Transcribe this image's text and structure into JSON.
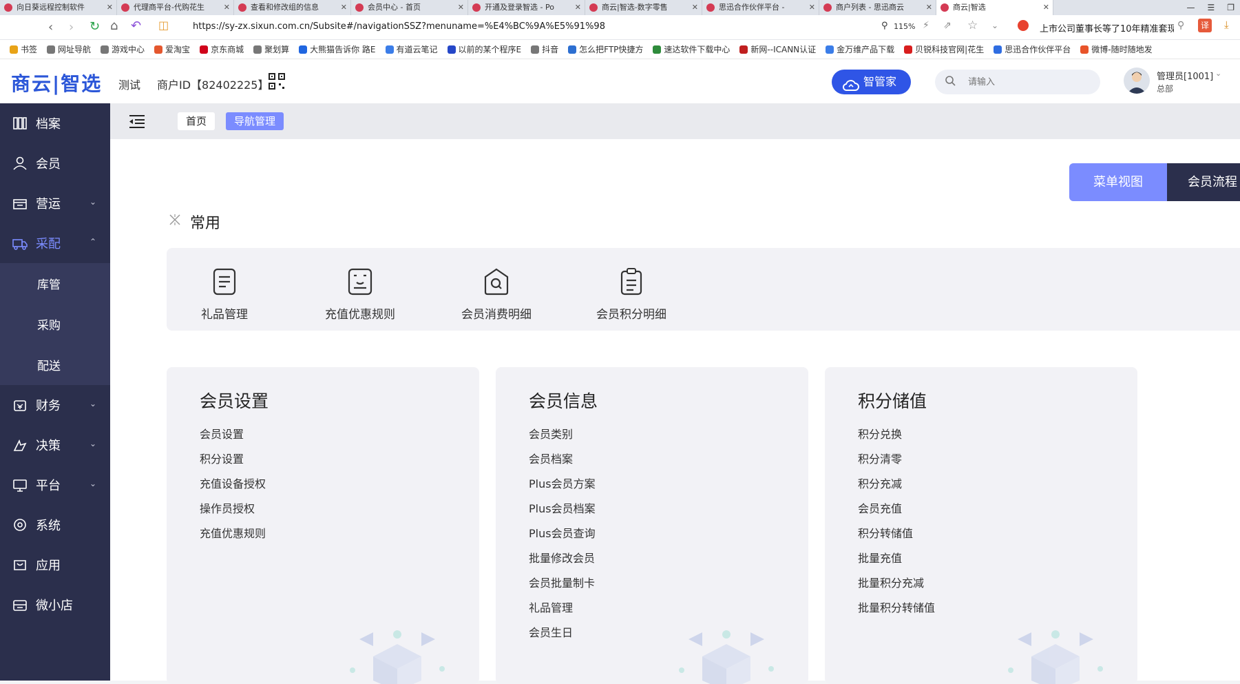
{
  "browser": {
    "tabs": [
      {
        "title": "向日葵远程控制软件",
        "active": false
      },
      {
        "title": "代理商平台-代购花生",
        "active": false
      },
      {
        "title": "查看和修改组的信息",
        "active": false
      },
      {
        "title": "会员中心 - 首页",
        "active": false
      },
      {
        "title": "开通及登录智选 - Po",
        "active": false
      },
      {
        "title": "商云|智选-数字零售",
        "active": false
      },
      {
        "title": "思迅合作伙伴平台 -",
        "active": false
      },
      {
        "title": "商户列表 - 思迅商云",
        "active": false
      },
      {
        "title": "商云|智选",
        "active": true
      }
    ],
    "url": "https://sy-zx.sixun.com.cn/Subsite#/navigationSSZ?menuname=%E4%BC%9A%E5%91%98",
    "zoom": "115%",
    "news_text": "上市公司董事长等了10年精准套现",
    "translate_label": "译",
    "bookmarks": [
      "书签",
      "网址导航",
      "游戏中心",
      "爱淘宝",
      "京东商城",
      "聚划算",
      "大熊猫告诉你 路E",
      "有道云笔记",
      "以前的某个程序E",
      "抖音",
      "怎么把FTP快捷方",
      "速达软件下载中心",
      "新网--ICANN认证",
      "金万维产品下载",
      "贝锐科技官网|花生",
      "思迅合作伙伴平台",
      "微博-随时随地发"
    ]
  },
  "header": {
    "logo": "商云|智选",
    "env": "测试",
    "merchant": "商户ID【82402225】",
    "assistant_button": "智管家",
    "search_placeholder": "请输入",
    "user_name": "管理员[1001]",
    "user_org": "总部"
  },
  "sidebar": {
    "items": [
      {
        "label": "档案",
        "icon": "archive-icon",
        "chevron": false
      },
      {
        "label": "会员",
        "icon": "user-icon",
        "chevron": false
      },
      {
        "label": "营运",
        "icon": "shop-icon",
        "chevron": true
      },
      {
        "label": "采配",
        "icon": "truck-icon",
        "chevron": true
      }
    ],
    "sub_items": [
      "库管",
      "采购",
      "配送"
    ],
    "items_after": [
      {
        "label": "财务",
        "icon": "wallet-icon",
        "chevron": true
      },
      {
        "label": "决策",
        "icon": "decision-icon",
        "chevron": true
      },
      {
        "label": "平台",
        "icon": "monitor-icon",
        "chevron": true
      },
      {
        "label": "系统",
        "icon": "settings-icon",
        "chevron": false
      },
      {
        "label": "应用",
        "icon": "app-icon",
        "chevron": false
      },
      {
        "label": "微小店",
        "icon": "store-icon",
        "chevron": false
      }
    ]
  },
  "toolbar": {
    "breadcrumb_home": "首页",
    "breadcrumb_current": "导航管理"
  },
  "view_tabs": {
    "menu_view": "菜单视图",
    "member_flow": "会员流程"
  },
  "common": {
    "title": "常用",
    "items": [
      "礼品管理",
      "充值优惠规则",
      "会员消费明细",
      "会员积分明细"
    ]
  },
  "cards": [
    {
      "title": "会员设置",
      "items": [
        "会员设置",
        "积分设置",
        "充值设备授权",
        "操作员授权",
        "充值优惠规则"
      ]
    },
    {
      "title": "会员信息",
      "items": [
        "会员类别",
        "会员档案",
        "Plus会员方案",
        "Plus会员档案",
        "Plus会员查询",
        "批量修改会员",
        "会员批量制卡",
        "礼品管理",
        "会员生日"
      ]
    },
    {
      "title": "积分储值",
      "items": [
        "积分兑换",
        "积分清零",
        "积分充减",
        "会员充值",
        "积分转储值",
        "批量充值",
        "批量积分充减",
        "批量积分转储值"
      ]
    }
  ],
  "colors": {
    "sidebar_bg": "#2b2f4c",
    "accent": "#7b8cff",
    "brand": "#2c57d8",
    "assistant": "#2f55e6"
  }
}
